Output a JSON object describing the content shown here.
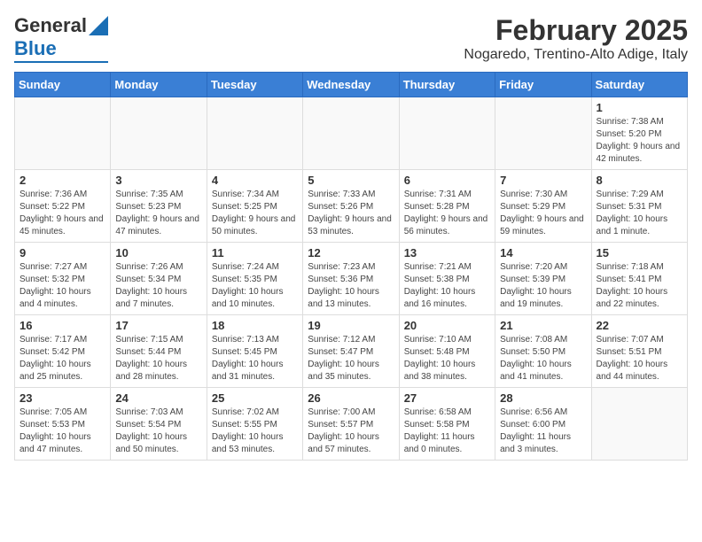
{
  "header": {
    "logo_general": "General",
    "logo_blue": "Blue",
    "month": "February 2025",
    "location": "Nogaredo, Trentino-Alto Adige, Italy"
  },
  "weekdays": [
    "Sunday",
    "Monday",
    "Tuesday",
    "Wednesday",
    "Thursday",
    "Friday",
    "Saturday"
  ],
  "weeks": [
    [
      {
        "day": "",
        "info": ""
      },
      {
        "day": "",
        "info": ""
      },
      {
        "day": "",
        "info": ""
      },
      {
        "day": "",
        "info": ""
      },
      {
        "day": "",
        "info": ""
      },
      {
        "day": "",
        "info": ""
      },
      {
        "day": "1",
        "info": "Sunrise: 7:38 AM\nSunset: 5:20 PM\nDaylight: 9 hours and 42 minutes."
      }
    ],
    [
      {
        "day": "2",
        "info": "Sunrise: 7:36 AM\nSunset: 5:22 PM\nDaylight: 9 hours and 45 minutes."
      },
      {
        "day": "3",
        "info": "Sunrise: 7:35 AM\nSunset: 5:23 PM\nDaylight: 9 hours and 47 minutes."
      },
      {
        "day": "4",
        "info": "Sunrise: 7:34 AM\nSunset: 5:25 PM\nDaylight: 9 hours and 50 minutes."
      },
      {
        "day": "5",
        "info": "Sunrise: 7:33 AM\nSunset: 5:26 PM\nDaylight: 9 hours and 53 minutes."
      },
      {
        "day": "6",
        "info": "Sunrise: 7:31 AM\nSunset: 5:28 PM\nDaylight: 9 hours and 56 minutes."
      },
      {
        "day": "7",
        "info": "Sunrise: 7:30 AM\nSunset: 5:29 PM\nDaylight: 9 hours and 59 minutes."
      },
      {
        "day": "8",
        "info": "Sunrise: 7:29 AM\nSunset: 5:31 PM\nDaylight: 10 hours and 1 minute."
      }
    ],
    [
      {
        "day": "9",
        "info": "Sunrise: 7:27 AM\nSunset: 5:32 PM\nDaylight: 10 hours and 4 minutes."
      },
      {
        "day": "10",
        "info": "Sunrise: 7:26 AM\nSunset: 5:34 PM\nDaylight: 10 hours and 7 minutes."
      },
      {
        "day": "11",
        "info": "Sunrise: 7:24 AM\nSunset: 5:35 PM\nDaylight: 10 hours and 10 minutes."
      },
      {
        "day": "12",
        "info": "Sunrise: 7:23 AM\nSunset: 5:36 PM\nDaylight: 10 hours and 13 minutes."
      },
      {
        "day": "13",
        "info": "Sunrise: 7:21 AM\nSunset: 5:38 PM\nDaylight: 10 hours and 16 minutes."
      },
      {
        "day": "14",
        "info": "Sunrise: 7:20 AM\nSunset: 5:39 PM\nDaylight: 10 hours and 19 minutes."
      },
      {
        "day": "15",
        "info": "Sunrise: 7:18 AM\nSunset: 5:41 PM\nDaylight: 10 hours and 22 minutes."
      }
    ],
    [
      {
        "day": "16",
        "info": "Sunrise: 7:17 AM\nSunset: 5:42 PM\nDaylight: 10 hours and 25 minutes."
      },
      {
        "day": "17",
        "info": "Sunrise: 7:15 AM\nSunset: 5:44 PM\nDaylight: 10 hours and 28 minutes."
      },
      {
        "day": "18",
        "info": "Sunrise: 7:13 AM\nSunset: 5:45 PM\nDaylight: 10 hours and 31 minutes."
      },
      {
        "day": "19",
        "info": "Sunrise: 7:12 AM\nSunset: 5:47 PM\nDaylight: 10 hours and 35 minutes."
      },
      {
        "day": "20",
        "info": "Sunrise: 7:10 AM\nSunset: 5:48 PM\nDaylight: 10 hours and 38 minutes."
      },
      {
        "day": "21",
        "info": "Sunrise: 7:08 AM\nSunset: 5:50 PM\nDaylight: 10 hours and 41 minutes."
      },
      {
        "day": "22",
        "info": "Sunrise: 7:07 AM\nSunset: 5:51 PM\nDaylight: 10 hours and 44 minutes."
      }
    ],
    [
      {
        "day": "23",
        "info": "Sunrise: 7:05 AM\nSunset: 5:53 PM\nDaylight: 10 hours and 47 minutes."
      },
      {
        "day": "24",
        "info": "Sunrise: 7:03 AM\nSunset: 5:54 PM\nDaylight: 10 hours and 50 minutes."
      },
      {
        "day": "25",
        "info": "Sunrise: 7:02 AM\nSunset: 5:55 PM\nDaylight: 10 hours and 53 minutes."
      },
      {
        "day": "26",
        "info": "Sunrise: 7:00 AM\nSunset: 5:57 PM\nDaylight: 10 hours and 57 minutes."
      },
      {
        "day": "27",
        "info": "Sunrise: 6:58 AM\nSunset: 5:58 PM\nDaylight: 11 hours and 0 minutes."
      },
      {
        "day": "28",
        "info": "Sunrise: 6:56 AM\nSunset: 6:00 PM\nDaylight: 11 hours and 3 minutes."
      },
      {
        "day": "",
        "info": ""
      }
    ]
  ]
}
